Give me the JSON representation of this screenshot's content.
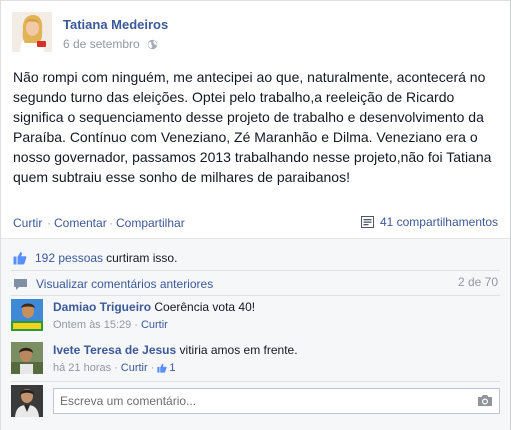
{
  "post": {
    "author": "Tatiana Medeiros",
    "date": "6 de setembro",
    "lines": [
      "Não rompi com ninguém, me antecipei ao que, naturalmente, acontecerá no",
      "segundo turno das eleições. Optei pelo trabalho,a reeleição de Ricardo",
      "significa o sequenciamento desse projeto de trabalho e desenvolvimento da",
      "Paraíba. Contínuo com Veneziano, Zé Maranhão e Dilma. Veneziano era o",
      "nosso governador, passamos 2013 trabalhando nesse projeto,não foi Tatiana",
      "quem subtraiu esse sonho de milhares de paraibanos!"
    ]
  },
  "actions": {
    "like": "Curtir",
    "comment": "Comentar",
    "share": "Compartilhar",
    "separator": "·",
    "shares": "41 compartilhamentos"
  },
  "ufi": {
    "likes_link": "192 pessoas",
    "likes_text": "curtiram isso.",
    "view_previous": "Visualizar comentários anteriores",
    "pager": "2 de 70",
    "comments": [
      {
        "name": "Damiao Trigueiro",
        "text": "Coerência vota 40!",
        "time": "Ontem às 15:29",
        "like": "Curtir"
      },
      {
        "name": "Ivete Teresa de Jesus",
        "text": "vitiria amos em frente.",
        "time": "há 21 horas",
        "like": "Curtir",
        "likes": "1"
      }
    ],
    "write_placeholder": "Escreva um comentário..."
  },
  "colors": {
    "link": "#3b5998",
    "meta": "#9197a3",
    "panel": "#f6f7f9"
  },
  "icons": {
    "privacy": "globe-icon",
    "share": "share-icon",
    "likes": "thumbs-up-icon",
    "comments": "speech-bubble-icon",
    "photo": "camera-icon"
  }
}
